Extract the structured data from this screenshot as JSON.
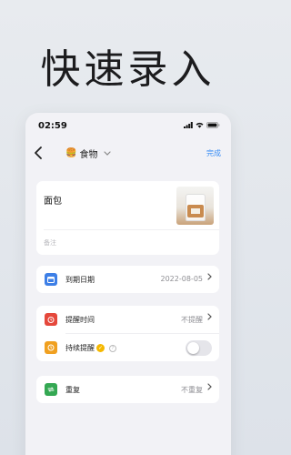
{
  "headline": "快速录入",
  "status": {
    "time": "02:59"
  },
  "nav": {
    "category_emoji": "🍔",
    "category": "食物",
    "done_label": "完成"
  },
  "item": {
    "name": "面包",
    "note_placeholder": "备注"
  },
  "rows": {
    "expiry": {
      "label": "到期日期",
      "value": "2022-08-05",
      "color": "#3d7fe6"
    },
    "reminder": {
      "label": "提醒时间",
      "value": "不提醒",
      "color": "#e5483c"
    },
    "persistent": {
      "label": "持续提醒",
      "enabled": false,
      "color": "#f0a020"
    },
    "repeat": {
      "label": "重复",
      "value": "不重复",
      "color": "#34a853"
    }
  }
}
